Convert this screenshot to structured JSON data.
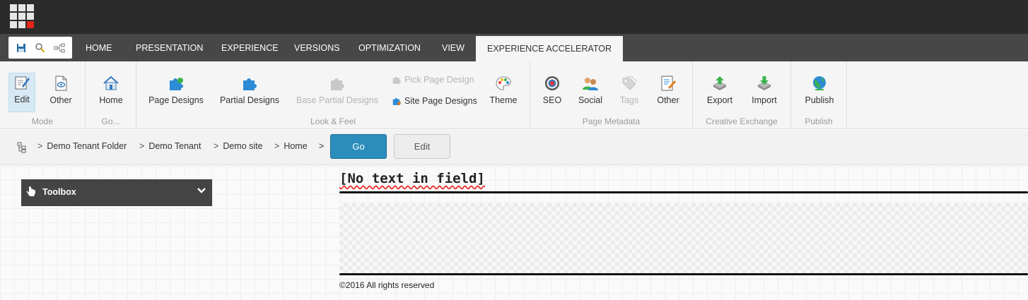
{
  "colors": {
    "topbar": "#2b2b2b",
    "tabstrip": "#474747",
    "accent": "#2b8dbc",
    "launchpad_red": "#e4281c"
  },
  "quick_access": [
    "save-icon",
    "search-icon",
    "navigation-tree-icon"
  ],
  "tabs": [
    {
      "label": "HOME"
    },
    {
      "label": "PRESENTATION"
    },
    {
      "label": "EXPERIENCE"
    },
    {
      "label": "VERSIONS"
    },
    {
      "label": "OPTIMIZATION"
    },
    {
      "label": "VIEW"
    },
    {
      "label": "EXPERIENCE ACCELERATOR",
      "active": true
    }
  ],
  "ribbon": {
    "mode": {
      "label": "Mode",
      "edit": "Edit",
      "other": "Other"
    },
    "go": {
      "label": "Go...",
      "home": "Home"
    },
    "look_feel": {
      "label": "Look & Feel",
      "page_designs": "Page Designs",
      "partial_designs": "Partial Designs",
      "base_partial_designs": "Base Partial Designs",
      "pick_page_design": "Pick Page Design",
      "site_page_designs": "Site Page Designs",
      "theme": "Theme"
    },
    "page_metadata": {
      "label": "Page Metadata",
      "seo": "SEO",
      "social": "Social",
      "tags": "Tags",
      "other": "Other"
    },
    "creative_exchange": {
      "label": "Creative Exchange",
      "export": "Export",
      "import": "Import"
    },
    "publish": {
      "label": "Publish",
      "publish": "Publish"
    }
  },
  "breadcrumb": {
    "items": [
      "Demo Tenant Folder",
      "Demo Tenant",
      "Demo site",
      "Home"
    ],
    "separator": ">",
    "go_label": "Go",
    "edit_label": "Edit"
  },
  "toolbox": {
    "label": "Toolbox"
  },
  "page": {
    "field_title": "[No text in field]",
    "footer": "©2016 All rights reserved"
  }
}
